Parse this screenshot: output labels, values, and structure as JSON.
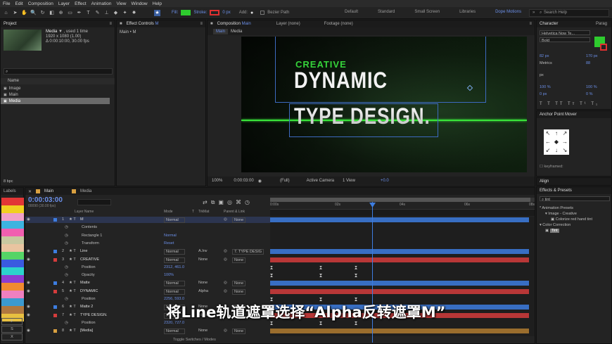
{
  "menu": [
    "File",
    "Edit",
    "Composition",
    "Layer",
    "Effect",
    "Animation",
    "View",
    "Window",
    "Help"
  ],
  "toolbar": {
    "fill_label": "Fill:",
    "stroke_label": "Stroke:",
    "stroke_px": "0 px",
    "add_label": "Add:",
    "bezier_label": "Bezier Path",
    "fill_color": "#2ecc2e",
    "stroke_color": "#e03030"
  },
  "workspaces": [
    "Default",
    "Standard",
    "Small Screen",
    "Libraries",
    "Dope Motions"
  ],
  "search_help": "Search Help",
  "project": {
    "tab": "Project",
    "item_name": "Media",
    "item_used": "▼ , used 1 time",
    "item_size": "1920 x 1080 (1.00)",
    "item_dur": "Δ 0:00:10:00, 30.00 fps",
    "col_name": "Name",
    "items": [
      "Image",
      "Main",
      "Media"
    ],
    "footer": "8 bpc"
  },
  "effect_controls": {
    "tab": "Effect Controls",
    "tab_target": "M",
    "breadcrumb": "Main • M"
  },
  "composition": {
    "tab": "Composition",
    "tab_name": "Main",
    "sub_tabs": [
      "Main",
      "Media"
    ],
    "layer_tab": "Layer (none)",
    "footage_tab": "Footage (none)",
    "zoom": "100%",
    "time": "0:00:03:00",
    "res": "(Full)",
    "camera": "Active Camera",
    "view": "1 View",
    "exposure": "+0.0"
  },
  "preview_text": {
    "line1": "CREATIVE",
    "line2": "DYNAMIC",
    "line3": "TYPE DESIGN."
  },
  "character": {
    "tab": "Character",
    "tab2": "Parag",
    "font": "Helvetica Now Te...",
    "style": "Bold",
    "size": "82 px",
    "leading": "170 px",
    "tracking_label": "Metrics",
    "tracking": "88",
    "unit": "px",
    "vscale": "100 %",
    "hscale": "100 %",
    "baseline": "0 px",
    "tsume": "0 %"
  },
  "anchor": {
    "title": "Anchor Point Mover",
    "kf": "keyframed:"
  },
  "align": {
    "title": "Align"
  },
  "effects": {
    "title": "Effects & Presets",
    "search": "tint",
    "preset_group": "* Animation Presets",
    "preset_sub": "Image - Creative",
    "preset_item": "Colorize red hand tint",
    "color_group": "Color Correction",
    "color_item": "Tint"
  },
  "labels": {
    "title": "Labels",
    "colors": [
      "#e23636",
      "#f0d020",
      "#f0a0c8",
      "#3db4e0",
      "#f15fb0",
      "#c8c8a0",
      "#e9c4a0",
      "#55d466",
      "#3a5ae0",
      "#2cd2cc",
      "#8b3dd0",
      "#f08a30",
      "#f080c0",
      "#3c9ad0",
      "#b07840",
      "#e8c040"
    ],
    "letters": [
      "F",
      "S",
      "X"
    ]
  },
  "timeline": {
    "tabs": [
      "Main",
      "Media"
    ],
    "timecode": "0:00:03:00",
    "timecode_sub": "00090 (30.00 fps)",
    "col_layer": "Layer Name",
    "col_mode": "Mode",
    "col_t": "T",
    "col_trkmat": "TrkMat",
    "col_parent": "Parent & Link",
    "ruler": [
      "0:00s",
      "02s",
      "04s",
      "06s",
      "08s"
    ],
    "toggle": "Toggle Switches / Modes",
    "layers": [
      {
        "num": "1",
        "name": "M",
        "mode": "Normal",
        "trk": "",
        "parent": "None",
        "color": "#3d7de0"
      },
      {
        "num": "",
        "name": "Contents",
        "mode": "",
        "trk": "",
        "parent": "",
        "color": ""
      },
      {
        "num": "",
        "name": "Rectangle 1",
        "mode": "Normal",
        "trk": "",
        "parent": "",
        "color": ""
      },
      {
        "num": "",
        "name": "Transform",
        "mode": "Reset",
        "trk": "",
        "parent": "",
        "color": ""
      },
      {
        "num": "2",
        "name": "Line",
        "mode": "Normal",
        "trk": "A.Inv",
        "parent": "7. TYPE DESIG",
        "color": "#3d7de0"
      },
      {
        "num": "3",
        "name": "CREATIVE",
        "mode": "Normal",
        "trk": "None",
        "parent": "None",
        "color": "#d43c3c"
      },
      {
        "num": "",
        "name": "Position",
        "mode": "2312, 461.0",
        "trk": "",
        "parent": "",
        "color": ""
      },
      {
        "num": "",
        "name": "Opacity",
        "mode": "100%",
        "trk": "",
        "parent": "",
        "color": ""
      },
      {
        "num": "4",
        "name": "Matte",
        "mode": "Normal",
        "trk": "None",
        "parent": "None",
        "color": "#3d7de0"
      },
      {
        "num": "5",
        "name": "DYNAMIC",
        "mode": "Normal",
        "trk": "Alpha",
        "parent": "None",
        "color": "#d43c3c"
      },
      {
        "num": "",
        "name": "Position",
        "mode": "2256, 593.0",
        "trk": "",
        "parent": "",
        "color": ""
      },
      {
        "num": "6",
        "name": "Matte 2",
        "mode": "Normal",
        "trk": "None",
        "parent": "None",
        "color": "#3d7de0"
      },
      {
        "num": "7",
        "name": "TYPE DESIGN.",
        "mode": "Normal",
        "trk": "Alpha",
        "parent": "None",
        "color": "#d43c3c"
      },
      {
        "num": "",
        "name": "Position",
        "mode": "2320, 727.0",
        "trk": "",
        "parent": "",
        "color": ""
      },
      {
        "num": "8",
        "name": "[Media]",
        "mode": "Normal",
        "trk": "None",
        "parent": "None",
        "color": "#d8a040"
      }
    ]
  },
  "subtitle": "将Line轨道遮罩选择“Alpha反转遮罩M”"
}
